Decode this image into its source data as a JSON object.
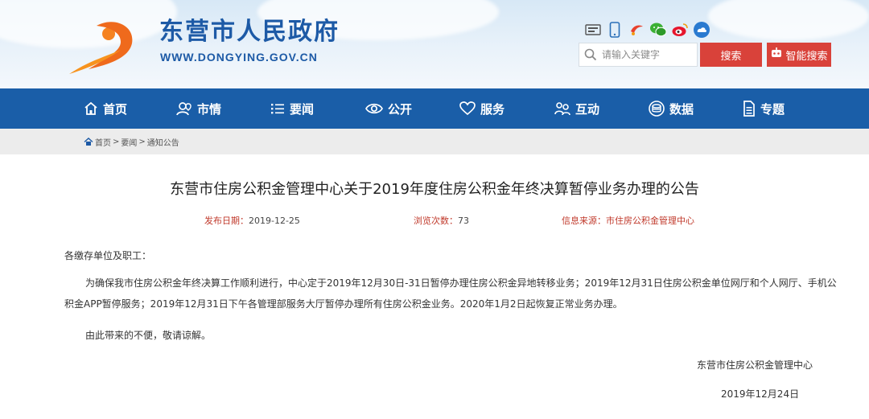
{
  "header": {
    "site_title": "东营市人民政府",
    "site_url": "WWW.DONGYING.GOV.CN",
    "search_placeholder": "请输入关键字",
    "search_button": "搜索",
    "smart_search_button": "智能搜索",
    "social_icons": [
      "weibo-government-icon",
      "mobile-icon",
      "toutiao-icon",
      "wechat-icon",
      "sina-weibo-icon",
      "cloud-app-icon"
    ]
  },
  "nav": {
    "items": [
      {
        "label": "首页",
        "icon": "home-icon"
      },
      {
        "label": "市情",
        "icon": "location-person-icon"
      },
      {
        "label": "要闻",
        "icon": "list-icon"
      },
      {
        "label": "公开",
        "icon": "eye-icon"
      },
      {
        "label": "服务",
        "icon": "heart-icon"
      },
      {
        "label": "互动",
        "icon": "chat-people-icon"
      },
      {
        "label": "数据",
        "icon": "database-icon"
      },
      {
        "label": "专题",
        "icon": "document-icon"
      }
    ]
  },
  "breadcrumb": {
    "items": [
      "首页",
      "要闻",
      "通知公告"
    ],
    "separator": ">"
  },
  "article": {
    "title": "东营市住房公积金管理中心关于2019年度住房公积金年终决算暂停业务办理的公告",
    "publish_label": "发布日期：",
    "publish_date": "2019-12-25",
    "views_label": "浏览次数：",
    "views": "73",
    "source_label": "信息来源：",
    "source": "市住房公积金管理中心",
    "salutation": "各缴存单位及职工：",
    "paragraph_1": "为确保我市住房公积金年终决算工作顺利进行，中心定于2019年12月30日-31日暂停办理住房公积金异地转移业务；2019年12月31日住房公积金单位网厅和个人网厅、手机公积金APP暂停服务；2019年12月31日下午各管理部服务大厅暂停办理所有住房公积金业务。2020年1月2日起恢复正常业务办理。",
    "paragraph_2": "由此带来的不便，敬请谅解。",
    "signature": "东营市住房公积金管理中心",
    "sign_date": "2019年12月24日"
  },
  "colors": {
    "nav_bg": "#1a5ea8",
    "brand_blue": "#1d5aa6",
    "search_red": "#d9423a",
    "logo_orange": "#ef6a1c"
  }
}
